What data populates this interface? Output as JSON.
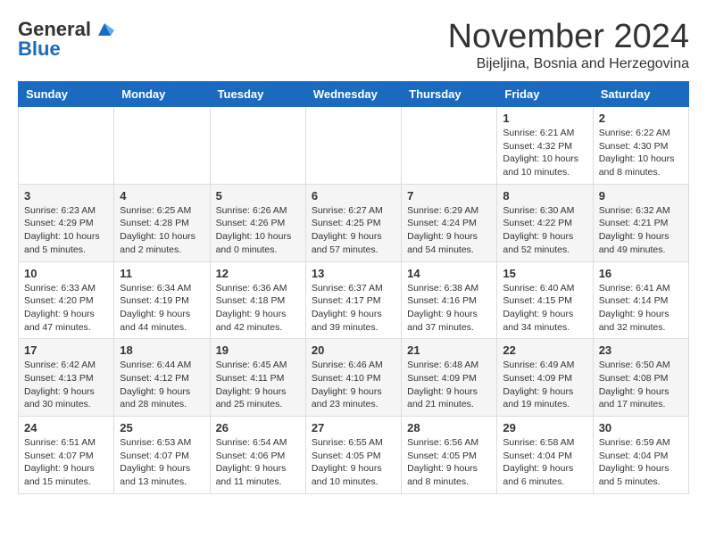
{
  "logo": {
    "line1": "General",
    "line2": "Blue"
  },
  "title": "November 2024",
  "subtitle": "Bijeljina, Bosnia and Herzegovina",
  "days_of_week": [
    "Sunday",
    "Monday",
    "Tuesday",
    "Wednesday",
    "Thursday",
    "Friday",
    "Saturday"
  ],
  "weeks": [
    [
      {
        "num": "",
        "info": ""
      },
      {
        "num": "",
        "info": ""
      },
      {
        "num": "",
        "info": ""
      },
      {
        "num": "",
        "info": ""
      },
      {
        "num": "",
        "info": ""
      },
      {
        "num": "1",
        "info": "Sunrise: 6:21 AM\nSunset: 4:32 PM\nDaylight: 10 hours and 10 minutes."
      },
      {
        "num": "2",
        "info": "Sunrise: 6:22 AM\nSunset: 4:30 PM\nDaylight: 10 hours and 8 minutes."
      }
    ],
    [
      {
        "num": "3",
        "info": "Sunrise: 6:23 AM\nSunset: 4:29 PM\nDaylight: 10 hours and 5 minutes."
      },
      {
        "num": "4",
        "info": "Sunrise: 6:25 AM\nSunset: 4:28 PM\nDaylight: 10 hours and 2 minutes."
      },
      {
        "num": "5",
        "info": "Sunrise: 6:26 AM\nSunset: 4:26 PM\nDaylight: 10 hours and 0 minutes."
      },
      {
        "num": "6",
        "info": "Sunrise: 6:27 AM\nSunset: 4:25 PM\nDaylight: 9 hours and 57 minutes."
      },
      {
        "num": "7",
        "info": "Sunrise: 6:29 AM\nSunset: 4:24 PM\nDaylight: 9 hours and 54 minutes."
      },
      {
        "num": "8",
        "info": "Sunrise: 6:30 AM\nSunset: 4:22 PM\nDaylight: 9 hours and 52 minutes."
      },
      {
        "num": "9",
        "info": "Sunrise: 6:32 AM\nSunset: 4:21 PM\nDaylight: 9 hours and 49 minutes."
      }
    ],
    [
      {
        "num": "10",
        "info": "Sunrise: 6:33 AM\nSunset: 4:20 PM\nDaylight: 9 hours and 47 minutes."
      },
      {
        "num": "11",
        "info": "Sunrise: 6:34 AM\nSunset: 4:19 PM\nDaylight: 9 hours and 44 minutes."
      },
      {
        "num": "12",
        "info": "Sunrise: 6:36 AM\nSunset: 4:18 PM\nDaylight: 9 hours and 42 minutes."
      },
      {
        "num": "13",
        "info": "Sunrise: 6:37 AM\nSunset: 4:17 PM\nDaylight: 9 hours and 39 minutes."
      },
      {
        "num": "14",
        "info": "Sunrise: 6:38 AM\nSunset: 4:16 PM\nDaylight: 9 hours and 37 minutes."
      },
      {
        "num": "15",
        "info": "Sunrise: 6:40 AM\nSunset: 4:15 PM\nDaylight: 9 hours and 34 minutes."
      },
      {
        "num": "16",
        "info": "Sunrise: 6:41 AM\nSunset: 4:14 PM\nDaylight: 9 hours and 32 minutes."
      }
    ],
    [
      {
        "num": "17",
        "info": "Sunrise: 6:42 AM\nSunset: 4:13 PM\nDaylight: 9 hours and 30 minutes."
      },
      {
        "num": "18",
        "info": "Sunrise: 6:44 AM\nSunset: 4:12 PM\nDaylight: 9 hours and 28 minutes."
      },
      {
        "num": "19",
        "info": "Sunrise: 6:45 AM\nSunset: 4:11 PM\nDaylight: 9 hours and 25 minutes."
      },
      {
        "num": "20",
        "info": "Sunrise: 6:46 AM\nSunset: 4:10 PM\nDaylight: 9 hours and 23 minutes."
      },
      {
        "num": "21",
        "info": "Sunrise: 6:48 AM\nSunset: 4:09 PM\nDaylight: 9 hours and 21 minutes."
      },
      {
        "num": "22",
        "info": "Sunrise: 6:49 AM\nSunset: 4:09 PM\nDaylight: 9 hours and 19 minutes."
      },
      {
        "num": "23",
        "info": "Sunrise: 6:50 AM\nSunset: 4:08 PM\nDaylight: 9 hours and 17 minutes."
      }
    ],
    [
      {
        "num": "24",
        "info": "Sunrise: 6:51 AM\nSunset: 4:07 PM\nDaylight: 9 hours and 15 minutes."
      },
      {
        "num": "25",
        "info": "Sunrise: 6:53 AM\nSunset: 4:07 PM\nDaylight: 9 hours and 13 minutes."
      },
      {
        "num": "26",
        "info": "Sunrise: 6:54 AM\nSunset: 4:06 PM\nDaylight: 9 hours and 11 minutes."
      },
      {
        "num": "27",
        "info": "Sunrise: 6:55 AM\nSunset: 4:05 PM\nDaylight: 9 hours and 10 minutes."
      },
      {
        "num": "28",
        "info": "Sunrise: 6:56 AM\nSunset: 4:05 PM\nDaylight: 9 hours and 8 minutes."
      },
      {
        "num": "29",
        "info": "Sunrise: 6:58 AM\nSunset: 4:04 PM\nDaylight: 9 hours and 6 minutes."
      },
      {
        "num": "30",
        "info": "Sunrise: 6:59 AM\nSunset: 4:04 PM\nDaylight: 9 hours and 5 minutes."
      }
    ]
  ]
}
